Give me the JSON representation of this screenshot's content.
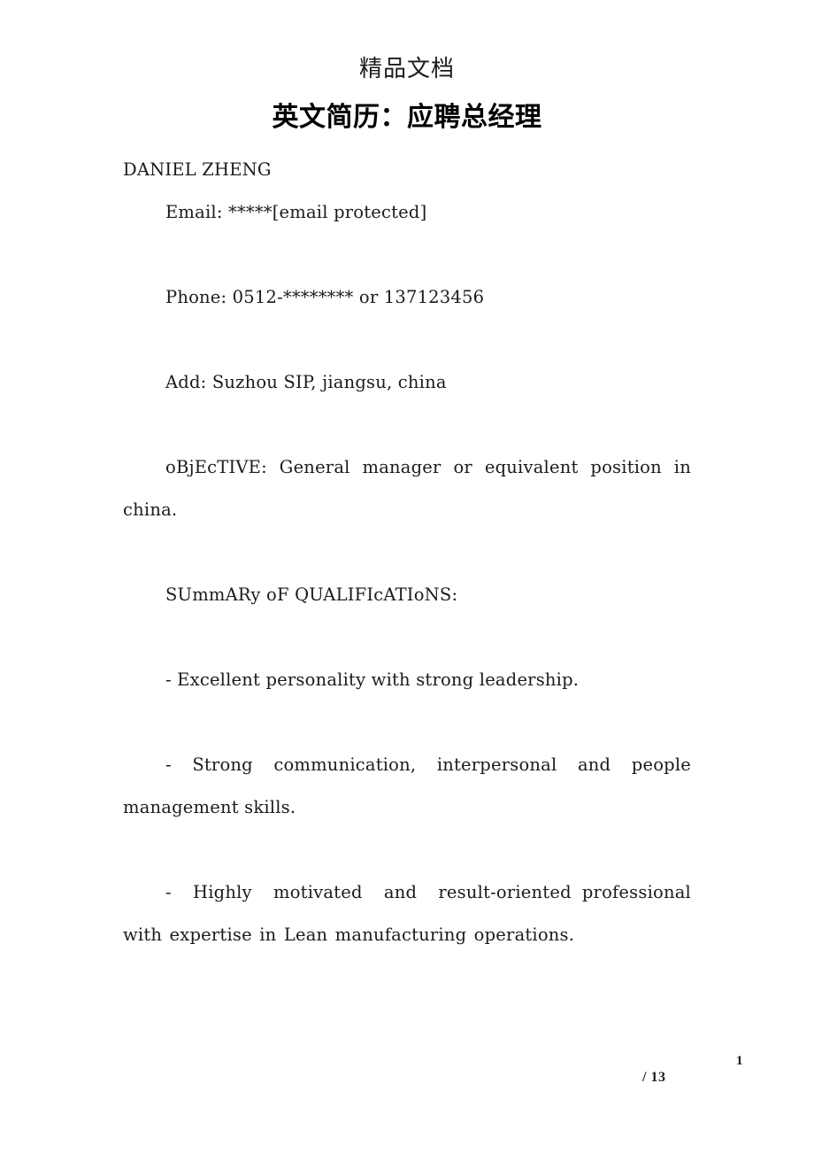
{
  "document": {
    "watermark_header": "精品文档",
    "title": "英文简历：应聘总经理",
    "body": {
      "name": "DANIEL ZHENG",
      "email_line": "Email: *****[email protected]",
      "phone_line": "Phone: 0512-******** or 137123456",
      "address_line": "Add: Suzhou SIP, jiangsu, china",
      "objective_line": "oBjEcTIVE: General manager or equivalent position in china.",
      "summary_heading": "SUmmARy oF QUALIFIcATIoNS:",
      "bullet_1": "- Excellent personality with strong leadership.",
      "bullet_2": "- Strong communication, interpersonal and people management skills.",
      "bullet_3": "-  Highly  motivated  and  result-oriented professional with expertise in Lean manufacturing operations."
    },
    "footer": {
      "page_number": "1",
      "page_total": "/ 13"
    },
    "colors": {
      "text": "#1b1b1b",
      "title": "#000000",
      "background": "#ffffff"
    }
  }
}
